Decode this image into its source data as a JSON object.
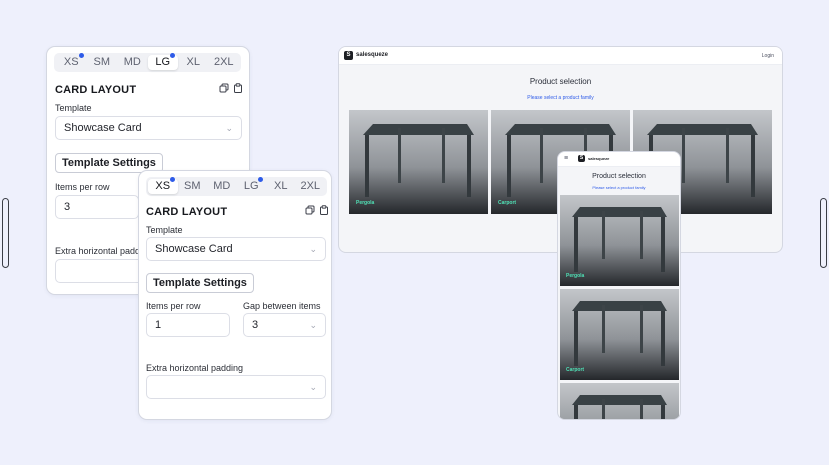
{
  "breakpoints": {
    "tabs": [
      "XS",
      "SM",
      "MD",
      "LG",
      "XL",
      "2XL"
    ],
    "active": "LG",
    "indicator_tabs": [
      "XS",
      "LG"
    ],
    "indicator_color": "#2e5be8"
  },
  "editor_back": {
    "section_title": "CARD LAYOUT",
    "template_label": "Template",
    "template_value": "Showcase Card",
    "settings_button": "Template Settings",
    "items_per_row_label": "Items per row",
    "items_per_row_value": "3",
    "padding_label": "Extra horizontal padding"
  },
  "editor_front": {
    "section_title": "CARD LAYOUT",
    "template_label": "Template",
    "template_value": "Showcase Card",
    "settings_button": "Template Settings",
    "items_per_row_label": "Items per row",
    "items_per_row_value": "1",
    "gap_label": "Gap between items",
    "gap_value": "3",
    "padding_label": "Extra horizontal padding",
    "padding_value": ""
  },
  "icons": {
    "copy": "copy-icon",
    "paste": "paste-icon",
    "chevron": "chevron-down-icon",
    "menu": "hamburger-menu-icon"
  },
  "desktop_preview": {
    "brand": "salesqueze",
    "logo_letter": "S",
    "login": "Login",
    "title": "Product selection",
    "subtitle": "Please select a product family",
    "cards": [
      "Pergola",
      "Carport",
      ""
    ]
  },
  "mobile_preview": {
    "brand": "salesqueze",
    "logo_letter": "S",
    "title": "Product selection",
    "subtitle": "Please select a product family",
    "cards": [
      "Pergola",
      "Carport",
      ""
    ]
  },
  "colors": {
    "background": "#eef0fc",
    "accent": "#2e5be8",
    "card_label": "#4fe0b5"
  }
}
